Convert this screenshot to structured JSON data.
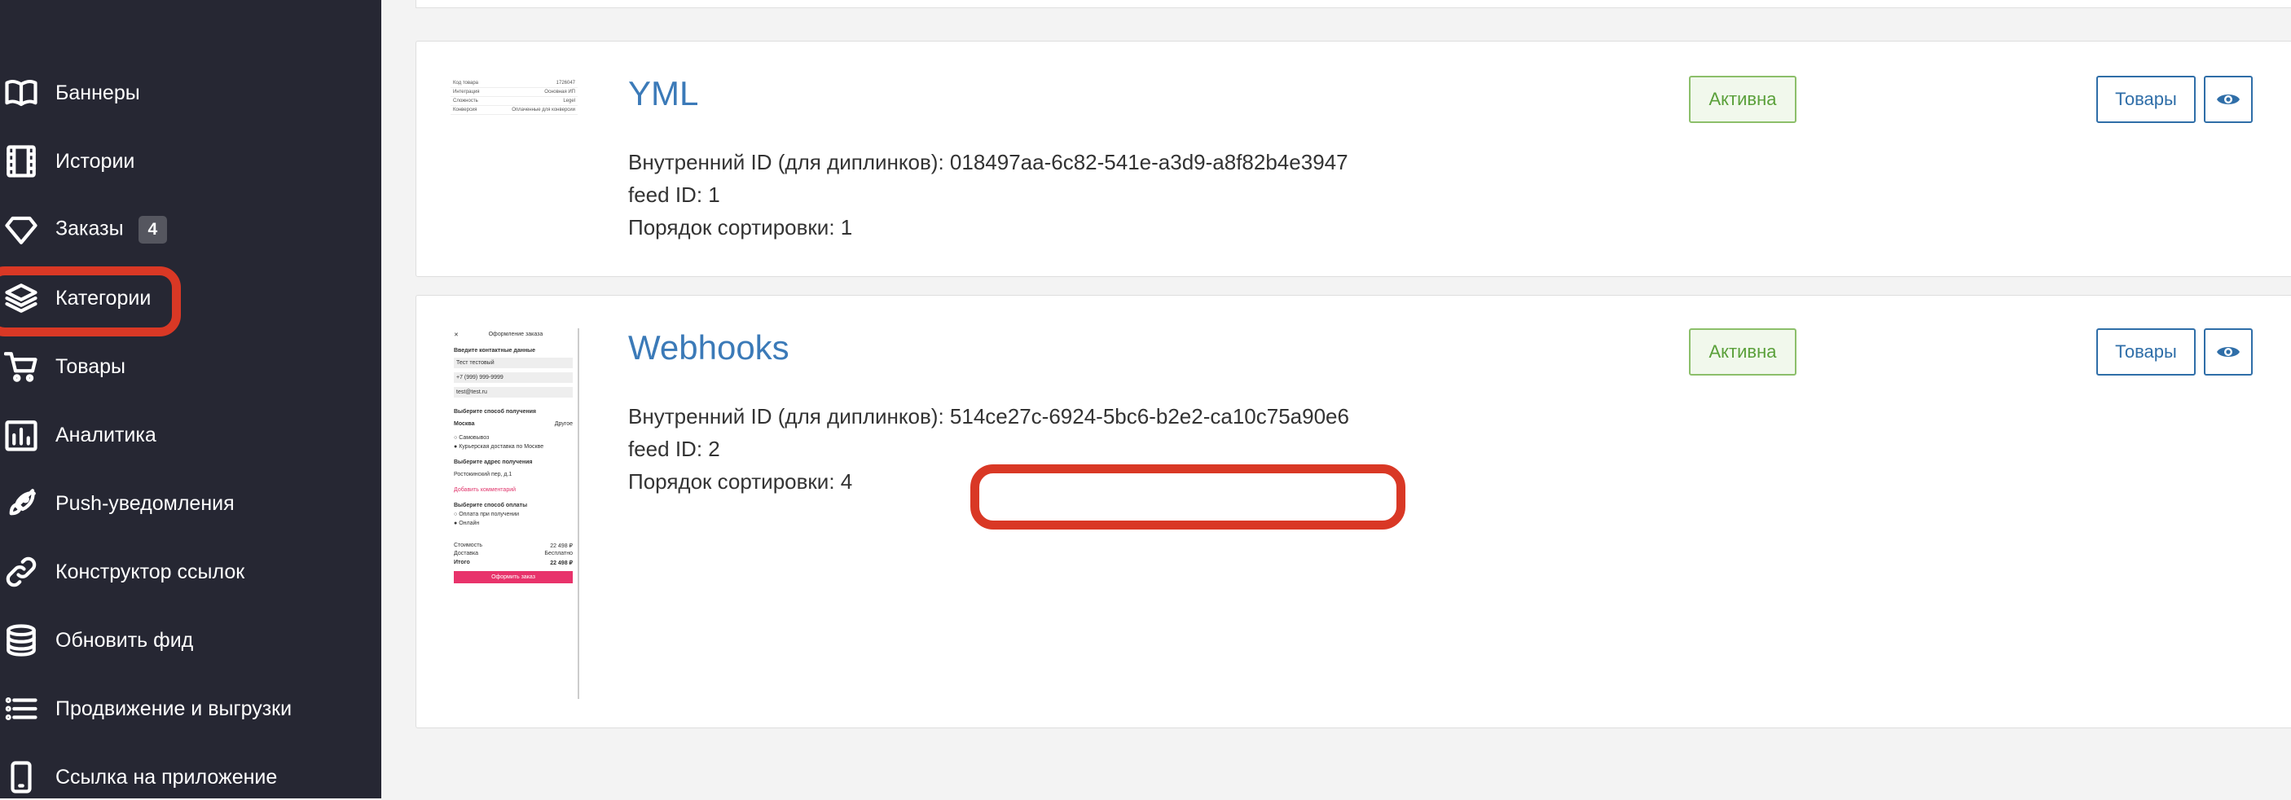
{
  "sidebar": {
    "items": [
      {
        "label": "Баннеры",
        "icon": "book-icon"
      },
      {
        "label": "Истории",
        "icon": "film-icon"
      },
      {
        "label": "Заказы",
        "icon": "diamond-icon",
        "badge": "4"
      },
      {
        "label": "Категории",
        "icon": "layers-icon"
      },
      {
        "label": "Товары",
        "icon": "cart-icon"
      },
      {
        "label": "Аналитика",
        "icon": "bar-chart-icon"
      },
      {
        "label": "Push-уведомления",
        "icon": "rocket-icon"
      },
      {
        "label": "Конструктор ссылок",
        "icon": "link-icon"
      },
      {
        "label": "Обновить фид",
        "icon": "database-icon"
      },
      {
        "label": "Продвижение и выгрузки",
        "icon": "list-icon"
      },
      {
        "label": "Ссылка на приложение",
        "icon": "phone-icon"
      }
    ]
  },
  "feeds": [
    {
      "title": "YML",
      "internal_id": "Внутренний ID (для диплинков): 018497aa-6c82-541e-a3d9-a8f82b4e3947",
      "feed_id": "feed ID: 1",
      "sort_order": "Порядок сортировки: 1",
      "status": "Активна",
      "goods_label": "Товары"
    },
    {
      "title": "Webhooks",
      "internal_id_prefix": "Внутренний ID (для диплинков): ",
      "internal_id_value": "514ce27c-6924-5bc6-b2e2-ca10c75a90e6",
      "feed_id": "feed ID: 2",
      "sort_order": "Порядок сортировки: 4",
      "status": "Активна",
      "goods_label": "Товары"
    }
  ],
  "thumb_yml": {
    "rows": [
      [
        "Код товара",
        "1726047"
      ],
      [
        "Интеграция",
        "Основная ИП"
      ],
      [
        "Сложность",
        "Legel"
      ],
      [
        "Конверсия",
        "Оплаченные для конверсии"
      ]
    ]
  },
  "thumb_webhooks": {
    "header": "Оформление заказа",
    "contacts_title": "Введите контактные данные",
    "name_value": "Тест тестовый",
    "phone_value": "+7 (999) 999-9999",
    "email_value": "test@test.ru",
    "delivery_title": "Выберите способ получения",
    "city": "Москва",
    "city_change": "Другое",
    "option1": "Самовывоз",
    "option2": "Курьерская доставка по Москве",
    "address_title": "Выберите адрес получения",
    "address": "Ростокинский пер, д.1",
    "comment_link": "Добавить комментарий",
    "payment_title": "Выберите способ оплаты",
    "pay1": "Оплата при получении",
    "pay2": "Онлайн",
    "cost_label": "Стоимость",
    "cost_value": "22 498 ₽",
    "delivery_label": "Доставка",
    "delivery_value": "Бесплатно",
    "total_label": "Итого",
    "total_value": "22 498 ₽",
    "submit": "Оформить заказ"
  },
  "colors": {
    "sidebar_bg": "#262733",
    "accent_title": "#3b7ab8",
    "highlight": "#d93825",
    "active_green": "#5aa03a"
  }
}
